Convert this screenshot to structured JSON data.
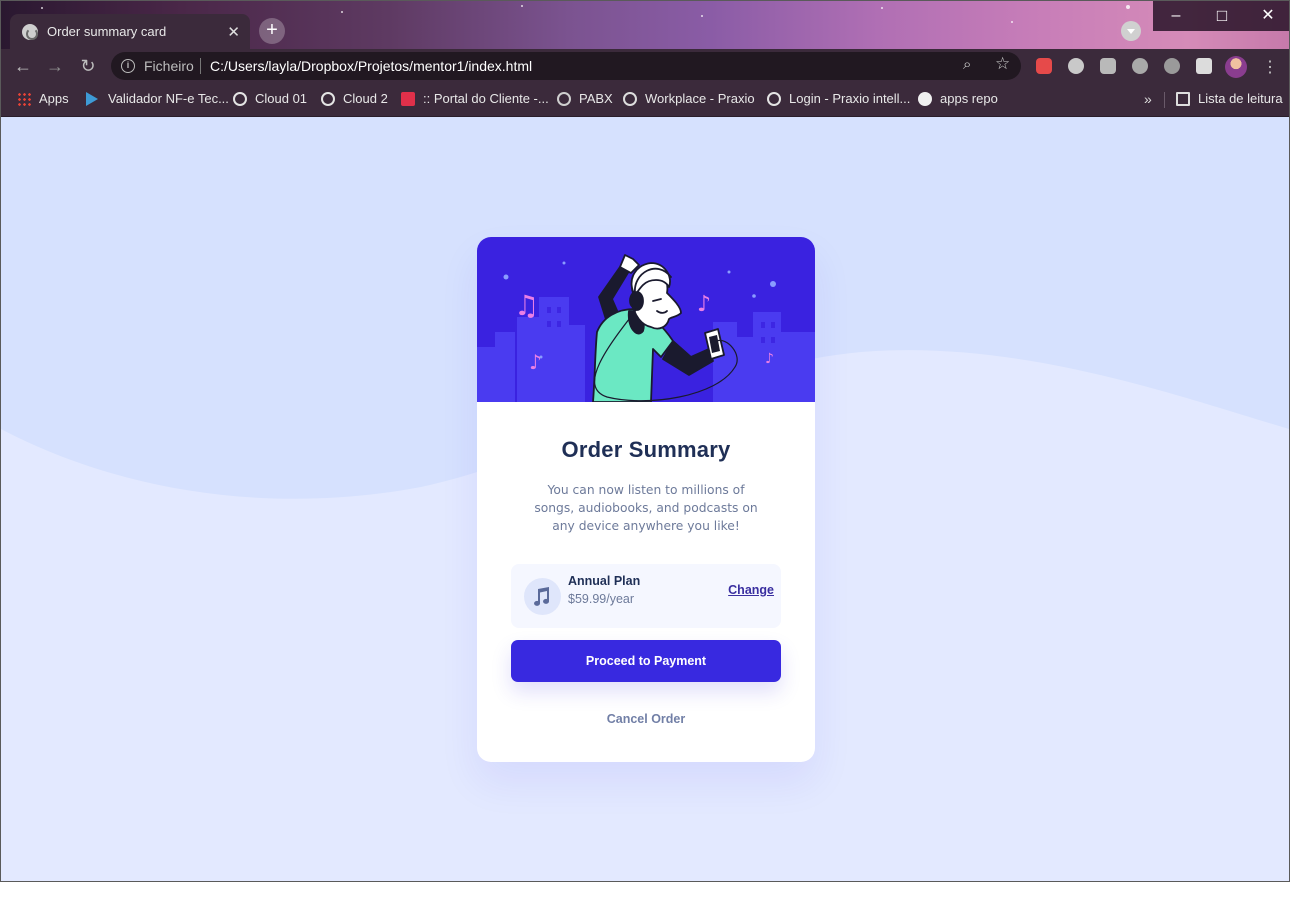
{
  "browser": {
    "tab_title": "Order summary card",
    "new_tab_symbol": "+",
    "scheme_label": "Ficheiro",
    "url": "C:/Users/layla/Dropbox/Projetos/mentor1/index.html",
    "window_controls": [
      "–",
      "□",
      "✕"
    ]
  },
  "bookmarks": [
    {
      "label": "Apps",
      "icon": "apps-grid-icon"
    },
    {
      "label": "Validador NF-e Tec...",
      "icon": "arrow-icon"
    },
    {
      "label": "Cloud 01",
      "icon": "globe-icon"
    },
    {
      "label": "Cloud 2",
      "icon": "globe-icon"
    },
    {
      "label": ":: Portal do Cliente -...",
      "icon": "pdf-icon"
    },
    {
      "label": "PABX",
      "icon": "pabx-icon"
    },
    {
      "label": "Workplace - Praxio",
      "icon": "workplace-icon"
    },
    {
      "label": "Login - Praxio intell...",
      "icon": "globe-icon"
    },
    {
      "label": "apps repo",
      "icon": "github-icon"
    }
  ],
  "reading_list": {
    "label": "Lista de leitura",
    "icon": "reading-list-icon"
  },
  "card": {
    "title": "Order Summary",
    "description": "You can now listen to millions of songs, audiobooks, and podcasts on any device anywhere you like!",
    "plan": {
      "name": "Annual Plan",
      "price": "$59.99/year",
      "change_label": "Change",
      "icon": "music-note-icon"
    },
    "proceed_label": "Proceed to Payment",
    "cancel_label": "Cancel Order"
  },
  "colors": {
    "page_background": "#d6e1fe",
    "primary_button": "#3829e0",
    "hero_background": "#3a22e0",
    "title_text": "#1f2f56",
    "body_text": "#6d7a9a"
  }
}
